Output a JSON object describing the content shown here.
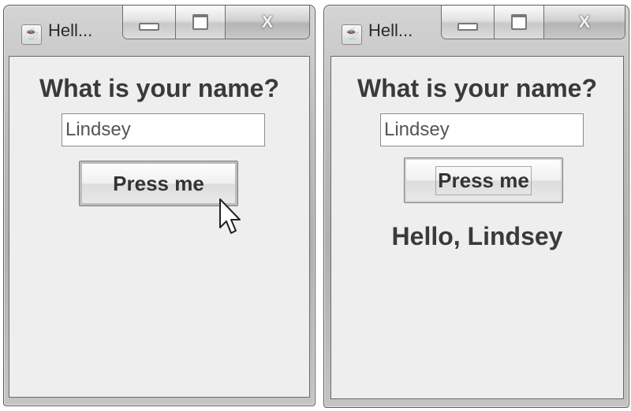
{
  "windows": [
    {
      "title": "Hell...",
      "question": "What is your name?",
      "name_input": "Lindsey",
      "button_label": "Press me"
    },
    {
      "title": "Hell...",
      "question": "What is your name?",
      "name_input": "Lindsey",
      "button_label": "Press me",
      "greeting": "Hello, Lindsey"
    }
  ],
  "icons": {
    "app": "java-coffee-cup-icon",
    "minimize": "minimize-icon",
    "maximize": "maximize-icon",
    "close": "close-icon",
    "cursor": "mouse-pointer-icon"
  }
}
